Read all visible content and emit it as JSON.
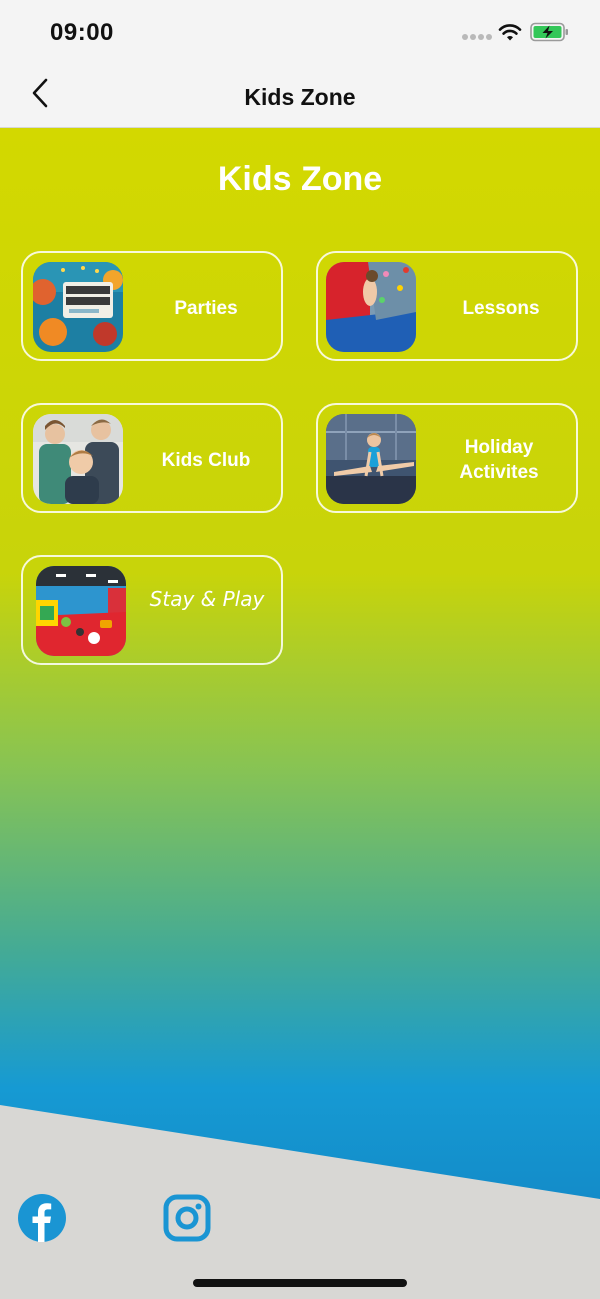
{
  "status": {
    "time": "09:00"
  },
  "nav": {
    "title": "Kids Zone",
    "back_icon": "chevron-left-icon"
  },
  "page": {
    "title": "Kids Zone"
  },
  "tiles": [
    {
      "label": "Parties",
      "image": "birthday-party-photo"
    },
    {
      "label": "Lessons",
      "image": "climbing-wall-photo"
    },
    {
      "label": "Kids Club",
      "image": "kids-group-photo"
    },
    {
      "label": "Holiday Activites",
      "label_line1": "Holiday",
      "label_line2": "Activites",
      "image": "gymnast-photo"
    },
    {
      "label": "Stay & Play",
      "image": "soft-play-photo"
    }
  ],
  "footer": {
    "icons": [
      "facebook-icon",
      "instagram-icon"
    ]
  },
  "colors": {
    "lime": "#d3d800",
    "blue": "#117fc0",
    "footer_grey": "#d8d7d4",
    "social_blue": "#1a95d3"
  }
}
